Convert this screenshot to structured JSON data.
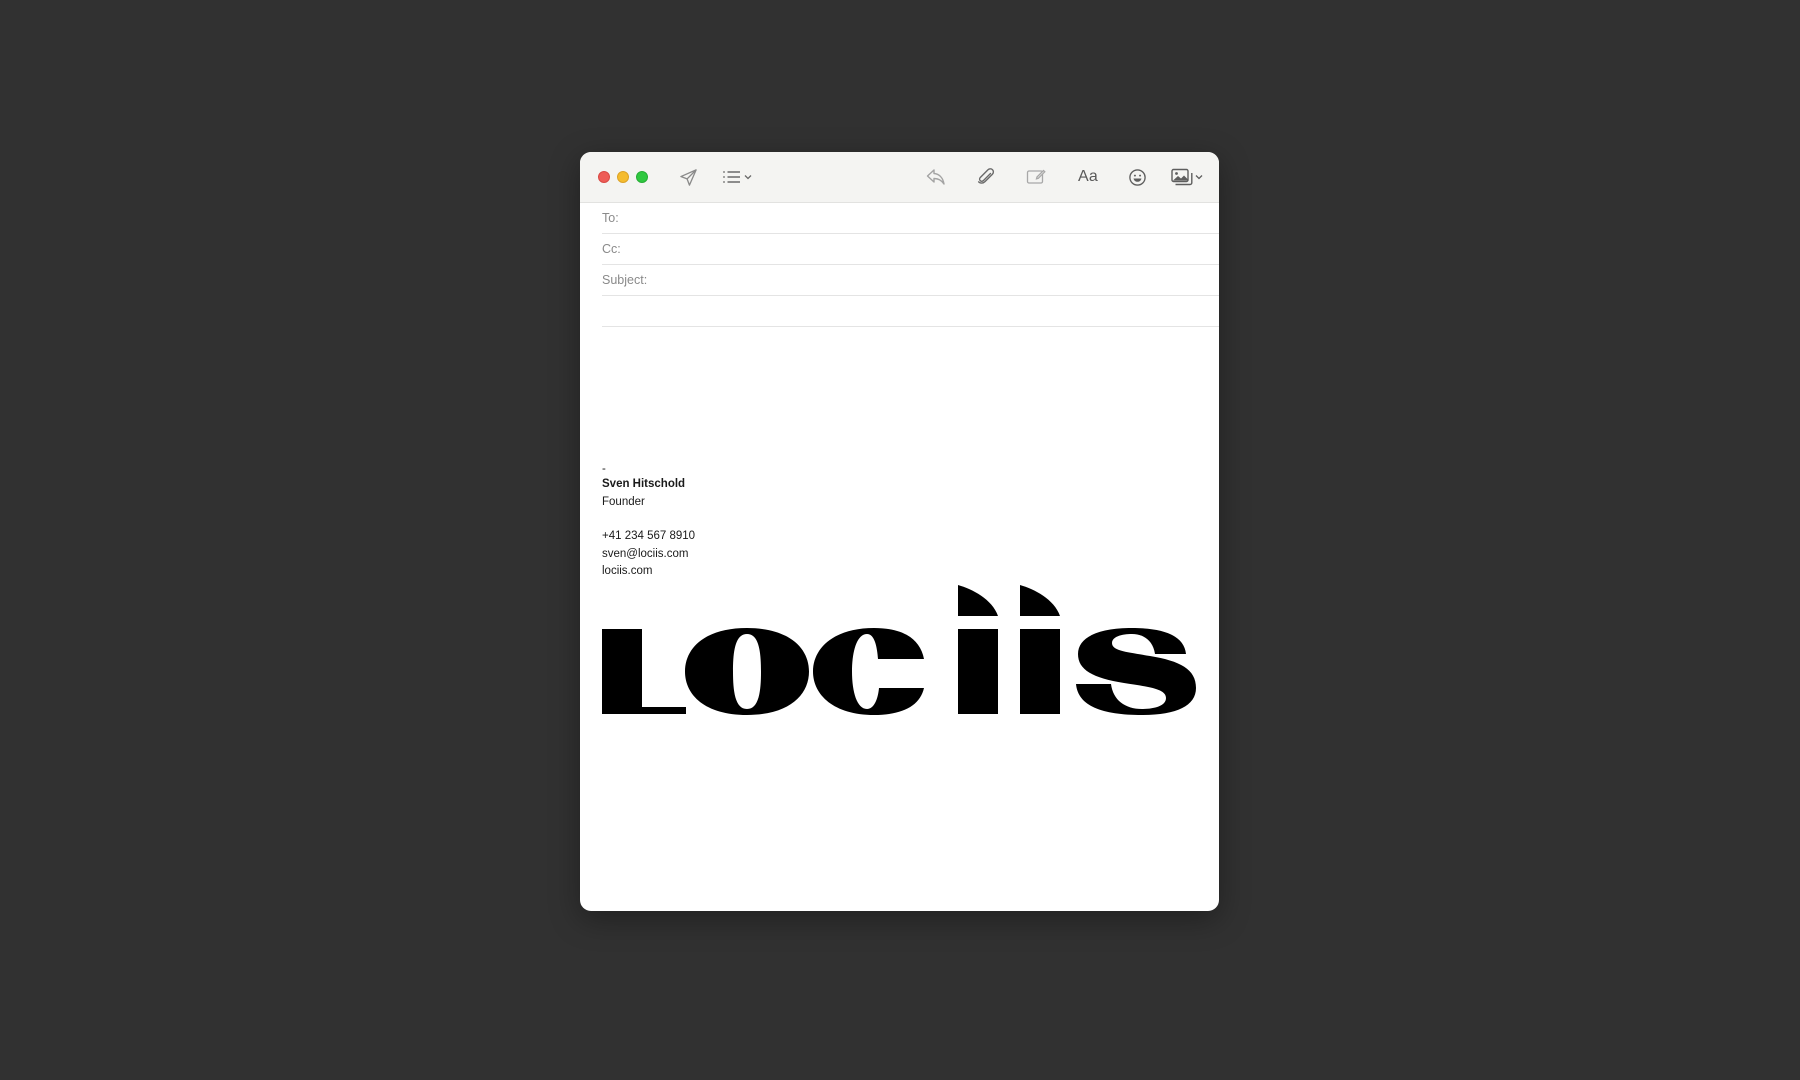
{
  "colors": {
    "desktop": "#313131",
    "toolbar": "#f4f4f2",
    "close": "#ee5c57",
    "minimize": "#f5bc2f",
    "zoom": "#2fc840",
    "logo": "#000000"
  },
  "toolbar": {
    "send_icon": "paper-plane-icon",
    "header_fields_icon": "list-icon",
    "reply_icon": "reply-icon",
    "attach_icon": "paperclip-icon",
    "markup_icon": "markup-icon",
    "format_label": "Aa",
    "emoji_icon": "smiley-icon",
    "photo_icon": "photo-browser-icon"
  },
  "fields": {
    "to_label": "To:",
    "to_value": "",
    "cc_label": "Cc:",
    "cc_value": "",
    "subject_label": "Subject:",
    "subject_value": ""
  },
  "signature": {
    "dash": "-",
    "name": "Sven Hitschold",
    "title": "Founder",
    "phone": "+41 234 567 8910",
    "email": "sven@lociis.com",
    "website": "lociis.com"
  },
  "logo": {
    "text": "lociis"
  }
}
